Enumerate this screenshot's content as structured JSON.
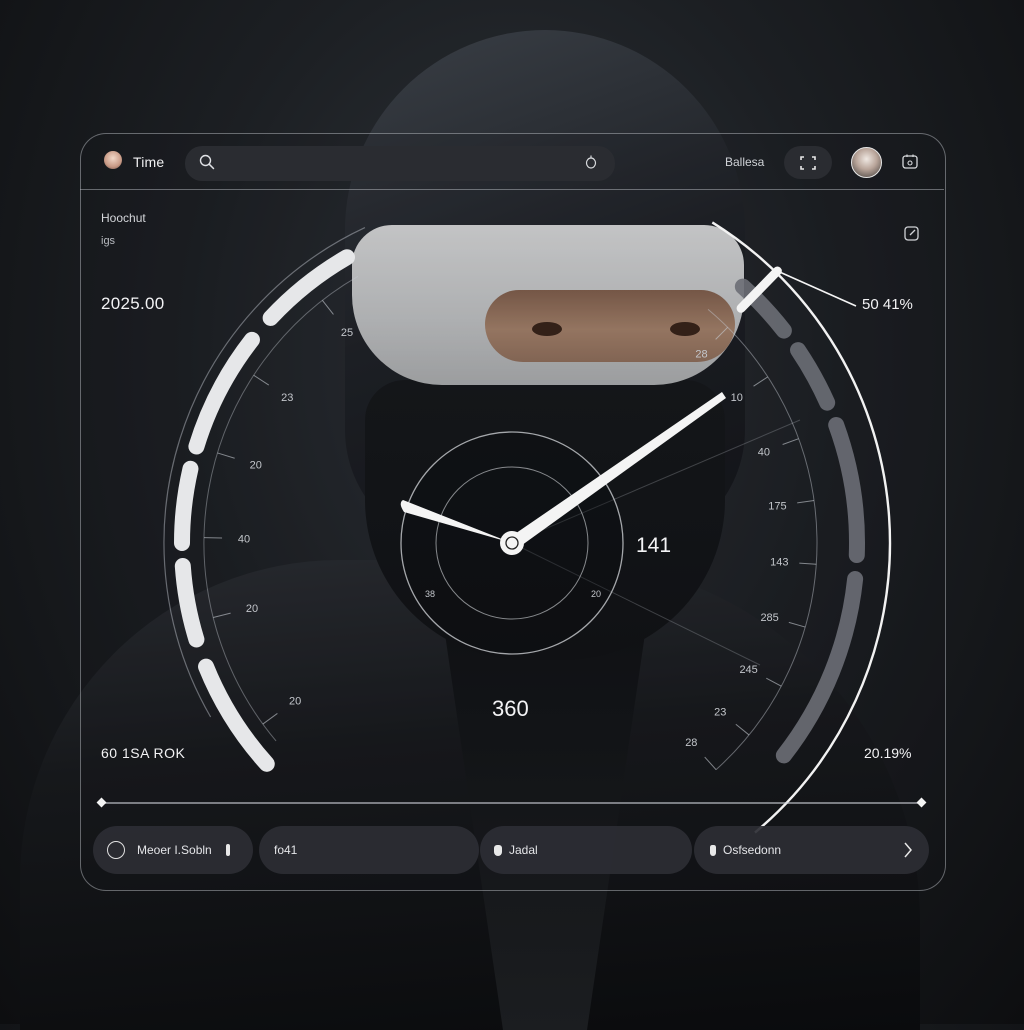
{
  "header": {
    "app_title": "Time",
    "search": {
      "placeholder": "",
      "value": ""
    },
    "status_label": "Ballesa",
    "icons": {
      "app_avatar": "person-avatar",
      "search": "search-icon",
      "mic": "mic-icon",
      "focus": "focus-frame-icon",
      "user_avatar": "user-avatar",
      "calendar": "calendar-icon"
    }
  },
  "side": {
    "title": "Hoochut",
    "subtitle": "igs",
    "expand_icon": "expand-icon"
  },
  "readouts": {
    "left_top": "2025.00",
    "right_top": "50 41%",
    "left_bottom": "60 1SA ROK",
    "right_bottom": "20.19%",
    "center_value": "360",
    "hand_value": "141"
  },
  "gauge": {
    "left_ticks": [
      "25",
      "23",
      "20",
      "40",
      "20",
      "20"
    ],
    "right_ticks": [
      "28",
      "10",
      "40",
      "175",
      "143",
      "285",
      "245",
      "23",
      "28"
    ],
    "inner_ticks": [
      "38",
      "20"
    ],
    "level_percent": 41
  },
  "slider": {
    "value_percent": 100
  },
  "tabs": [
    {
      "label": "Meoer I.Sobln",
      "icon": "radio-icon"
    },
    {
      "label": "fo41",
      "icon": ""
    },
    {
      "label": "Jadal",
      "icon": "lock-icon"
    },
    {
      "label": "Osfsedonn",
      "icon": "number-icon",
      "trailing_icon": "chevron-right-icon"
    }
  ],
  "colors": {
    "background": "#1c1f23",
    "panel_border": "#c8ccd2",
    "tab_bg": "#2c2e34",
    "text": "#f3f3f5",
    "gauge_segment": "#e6e7e9",
    "gauge_segment_dim": "#6b6e75"
  }
}
